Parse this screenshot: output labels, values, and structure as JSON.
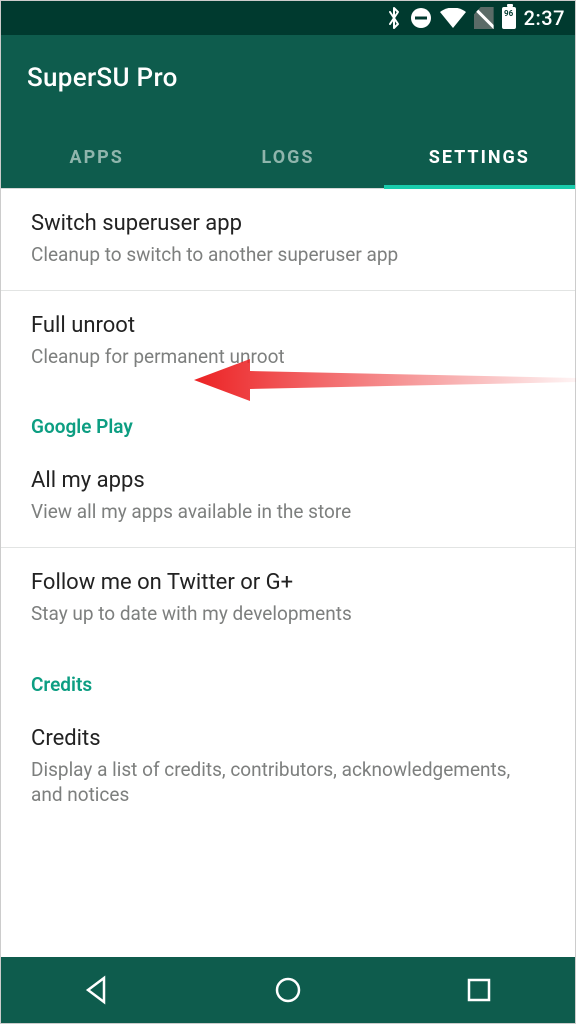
{
  "status": {
    "time": "2:37",
    "battery_pct": "96"
  },
  "header": {
    "title": "SuperSU Pro"
  },
  "tabs": {
    "apps": "APPS",
    "logs": "LOGS",
    "settings": "SETTINGS",
    "active_index": 2
  },
  "items": {
    "switch": {
      "title": "Switch superuser app",
      "subtitle": "Cleanup to switch to another superuser app"
    },
    "unroot": {
      "title": "Full unroot",
      "subtitle": "Cleanup for permanent unroot"
    },
    "googleplay_header": "Google Play",
    "allmyapps": {
      "title": "All my apps",
      "subtitle": "View all my apps available in the store"
    },
    "follow": {
      "title": "Follow me on Twitter or G+",
      "subtitle": "Stay up to date with my developments"
    },
    "credits_header": "Credits",
    "credits": {
      "title": "Credits",
      "subtitle": "Display a list of credits, contributors, acknowledgements, and notices"
    }
  }
}
